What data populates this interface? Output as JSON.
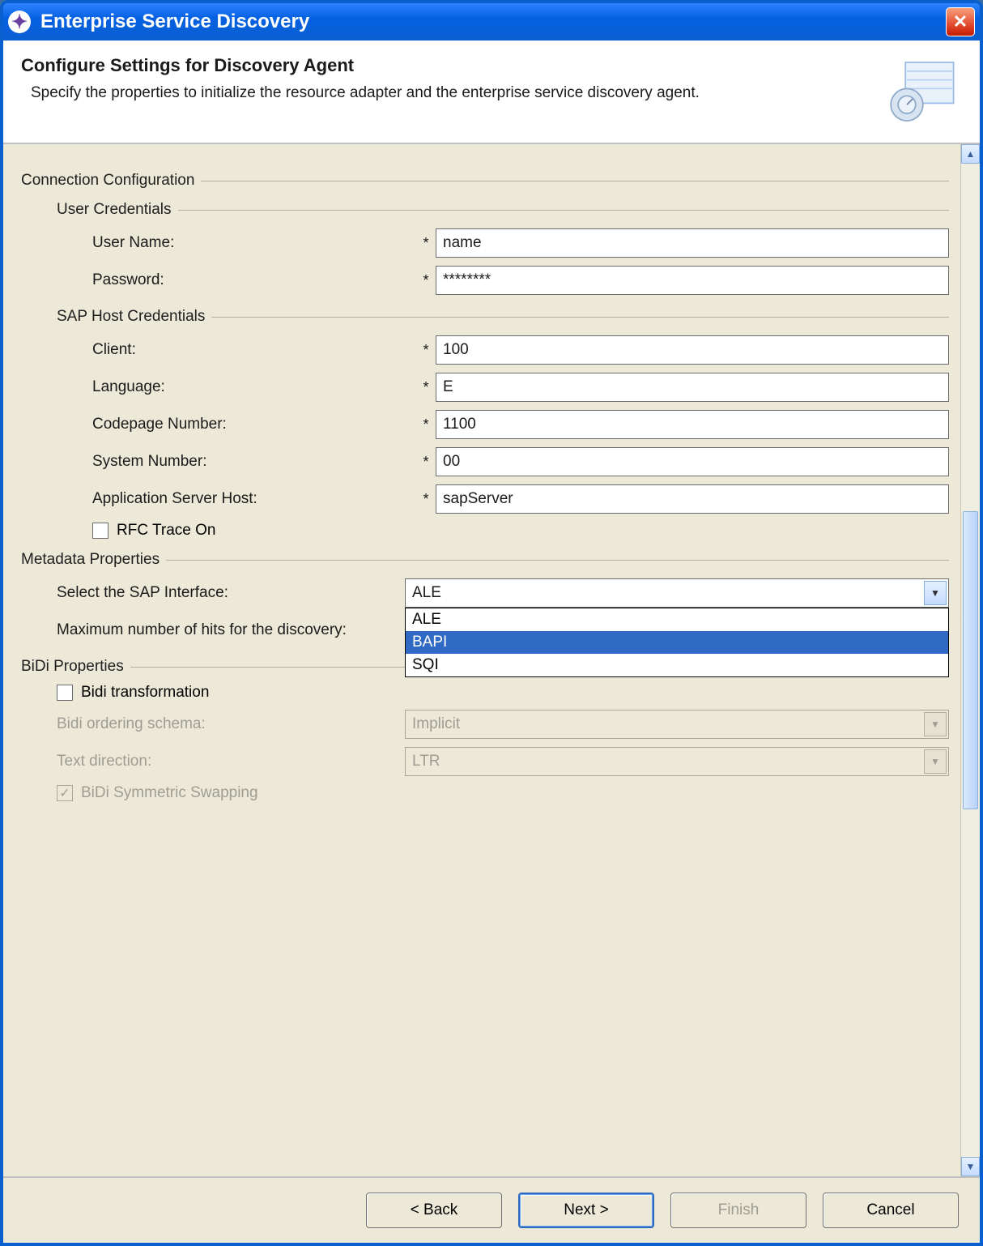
{
  "window": {
    "title": "Enterprise Service Discovery"
  },
  "header": {
    "title": "Configure Settings for Discovery Agent",
    "description": "Specify the properties to initialize the resource adapter and the enterprise service discovery agent."
  },
  "groups": {
    "connection": "Connection Configuration",
    "user_credentials": "User Credentials",
    "sap_host": "SAP Host Credentials",
    "metadata": "Metadata Properties",
    "bidi": "BiDi Properties"
  },
  "fields": {
    "username": {
      "label": "User Name:",
      "value": "name"
    },
    "password": {
      "label": "Password:",
      "value": "********"
    },
    "client": {
      "label": "Client:",
      "value": "100"
    },
    "language": {
      "label": "Language:",
      "value": "E"
    },
    "codepage": {
      "label": "Codepage Number:",
      "value": "1100"
    },
    "sysnum": {
      "label": "System Number:",
      "value": "00"
    },
    "appserver": {
      "label": "Application Server Host:",
      "value": "sapServer"
    },
    "rfc_trace": {
      "label": "RFC Trace On"
    },
    "sap_interface": {
      "label": "Select the SAP Interface:",
      "value": "ALE",
      "options": [
        "ALE",
        "BAPI",
        "SQI"
      ],
      "highlighted": "BAPI"
    },
    "max_hits": {
      "label": "Maximum number of hits for the discovery:"
    },
    "bidi_transform": {
      "label": "Bidi transformation"
    },
    "bidi_schema": {
      "label": "Bidi ordering schema:",
      "value": "Implicit"
    },
    "text_direction": {
      "label": "Text direction:",
      "value": "LTR"
    },
    "bidi_swap": {
      "label": "BiDi Symmetric Swapping"
    }
  },
  "required_marker": "*",
  "buttons": {
    "back": "< Back",
    "next": "Next >",
    "finish": "Finish",
    "cancel": "Cancel"
  }
}
